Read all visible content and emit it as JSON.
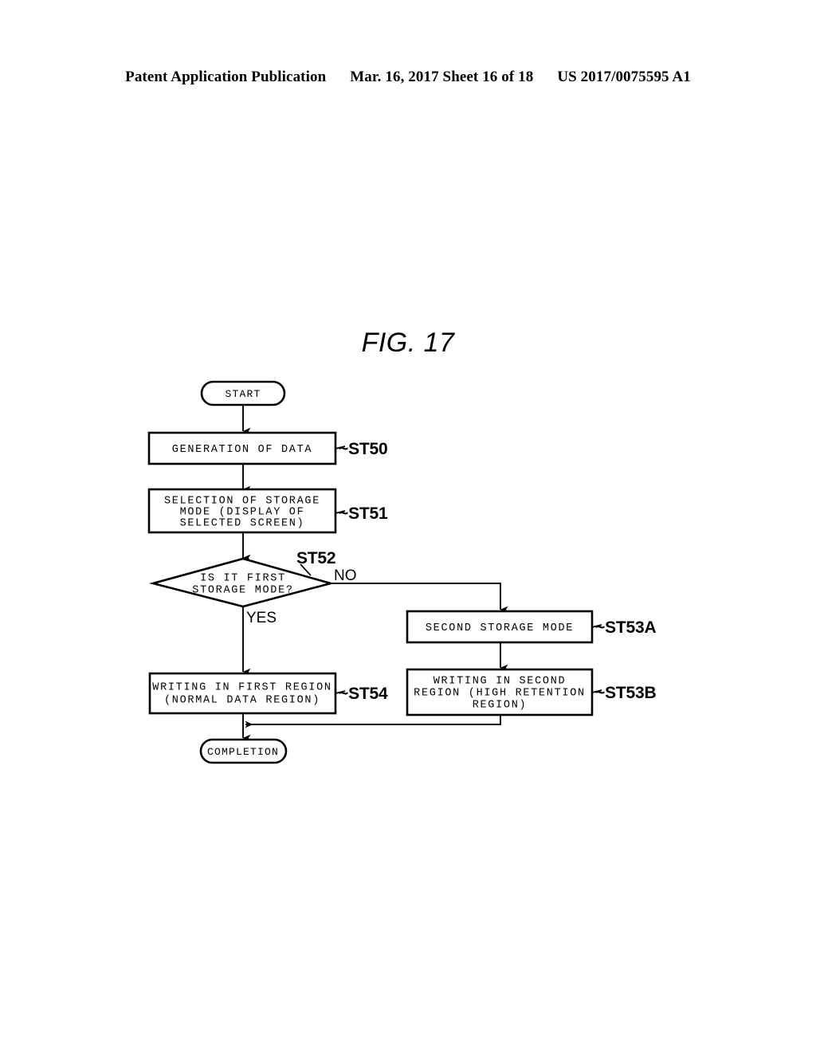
{
  "header": {
    "publication": "Patent Application Publication",
    "date_sheet": "Mar. 16, 2017  Sheet 16 of 18",
    "pub_number": "US 2017/0075595 A1"
  },
  "figure": {
    "title": "FIG. 17",
    "nodes": {
      "start": {
        "label": "START"
      },
      "st50": {
        "lines": [
          "GENERATION OF DATA"
        ],
        "ref": "~ST50"
      },
      "st51": {
        "lines": [
          "SELECTION OF STORAGE",
          "MODE (DISPLAY OF",
          "SELECTED SCREEN)"
        ],
        "ref": "~ST51"
      },
      "st52": {
        "lines": [
          "IS IT FIRST",
          "STORAGE MODE?"
        ],
        "ref": "ST52",
        "branch_no": "NO",
        "branch_yes": "YES"
      },
      "st53a": {
        "lines": [
          "SECOND STORAGE MODE"
        ],
        "ref": "~ST53A"
      },
      "st53b": {
        "lines": [
          "WRITING IN SECOND",
          "REGION (HIGH RETENTION",
          "REGION)"
        ],
        "ref": "~ST53B"
      },
      "st54": {
        "lines": [
          "WRITING IN FIRST REGION",
          "(NORMAL DATA REGION)"
        ],
        "ref": "~ST54"
      },
      "completion": {
        "label": "COMPLETION"
      }
    }
  },
  "colors": {
    "ink": "#000000",
    "paper": "#ffffff"
  }
}
